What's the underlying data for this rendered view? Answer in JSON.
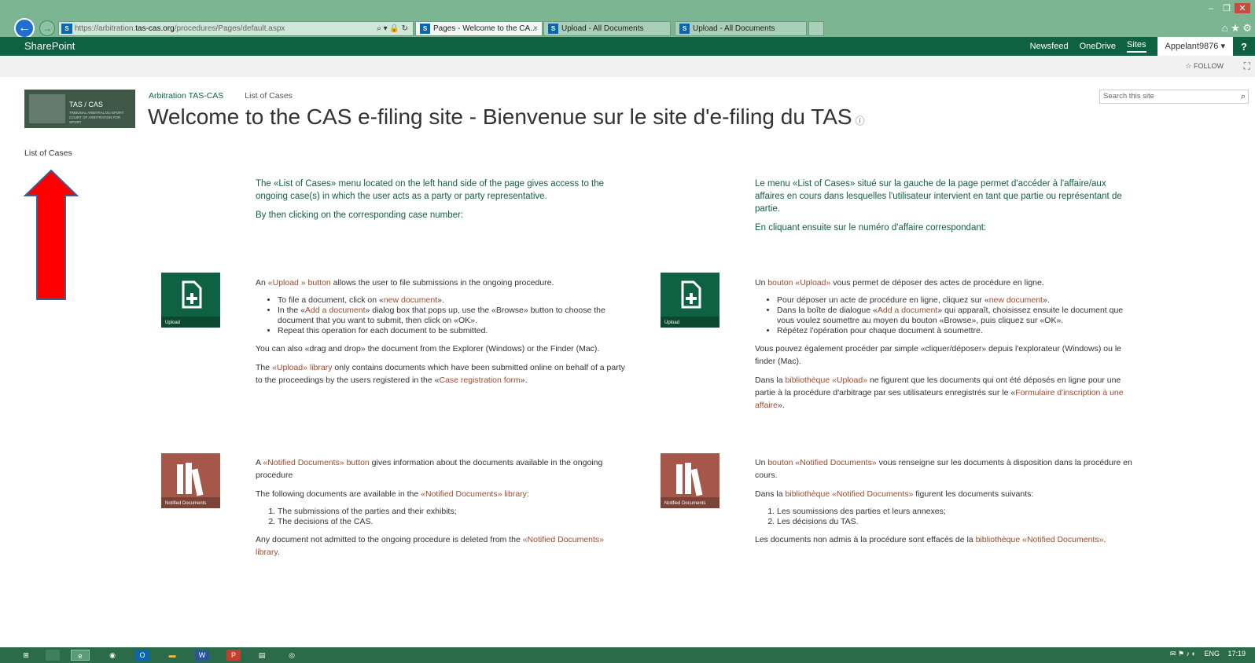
{
  "browser": {
    "url_prefix": "https://arbitration.",
    "url_host": "tas-cas.org",
    "url_path": "/procedures/Pages/default.aspx",
    "addr_icons": "⌕ ▾ 🔒 ↻",
    "tabs": [
      {
        "label": "Pages - Welcome to the CA...",
        "active": true
      },
      {
        "label": "Upload - All Documents"
      },
      {
        "label": "Upload - All Documents"
      }
    ],
    "tab_close": "×",
    "win_min": "–",
    "win_restore": "❐",
    "win_close": "✕",
    "home_icon": "⌂",
    "star_icon": "★",
    "gear_icon": "⚙"
  },
  "sp": {
    "brand": "SharePoint",
    "nav": [
      "Newsfeed",
      "OneDrive",
      "Sites"
    ],
    "user": "Appelant9876 ▾",
    "help": "?"
  },
  "ribbon": {
    "follow": "☆ FOLLOW",
    "focus": "⛶"
  },
  "logo": {
    "title": "TAS / CAS",
    "sub1": "TRIBUNAL ARBITRAL DU SPORT",
    "sub2": "COURT OF ARBITRATION FOR SPORT"
  },
  "breadcrumb": {
    "site": "Arbitration TAS-CAS",
    "page": "List of Cases"
  },
  "page_title": "Welcome to the CAS e-filing site - Bienvenue sur le site d'e-filing du TAS",
  "info_icon": "ⓘ",
  "search": {
    "placeholder": "Search this site",
    "icon": "⌕"
  },
  "left_nav": {
    "item": "List of Cases"
  },
  "en": {
    "intro1": "The «List of Cases» menu located on the left hand side of the page gives access to the ongoing case(s) in which the user acts as a party or party representative.",
    "intro2": "By then clicking on the corresponding case number:",
    "upload_a": "An ",
    "upload_link": "«Upload » button",
    "upload_b": " allows the user to file submissions in the ongoing procedure.",
    "b1_a": "To file a document, click on «",
    "b1_link": "new document",
    "b1_b": "».",
    "b2_a": "In the «",
    "b2_link": "Add a document",
    "b2_b": "» dialog box that pops up, use the «Browse» button to choose the document that you want to submit, then click on «OK».",
    "b3": "Repeat this operation for each document to be submitted.",
    "drag": "You can also «drag and drop» the document from the Explorer (Windows) or the Finder (Mac).",
    "lib_a": "The ",
    "lib_link": "«Upload» library",
    "lib_b": " only contains documents which have been submitted online on behalf of a party to the proceedings by the users registered in the «",
    "lib_link2": "Case registration form",
    "lib_c": "».",
    "nd_a": "A ",
    "nd_link": "«Notified Documents» button",
    "nd_b": " gives information about the documents available in the ongoing procedure",
    "nd2_a": "The following documents are available in the ",
    "nd2_link": "«Notified Documents» library",
    "nd2_b": ":",
    "o1": "The submissions of the parties and their exhibits;",
    "o2": "The decisions of the CAS.",
    "nd3_a": "Any document not admitted to the ongoing procedure is deleted from the ",
    "nd3_link": "«Notified Documents» library",
    "nd3_b": "."
  },
  "fr": {
    "intro1": "Le menu «List of Cases» situé sur la gauche de la page permet d'accéder à l'affaire/aux affaires en cours dans lesquelles l'utilisateur intervient en tant que partie ou représentant de partie.",
    "intro2": "En cliquant ensuite sur le numéro d'affaire correspondant:",
    "upload_a": "Un ",
    "upload_link": "bouton «Upload»",
    "upload_b": " vous permet de déposer des actes de procédure en ligne.",
    "b1_a": "Pour déposer un acte de procédure en ligne, cliquez sur «",
    "b1_link": "new document",
    "b1_b": "».",
    "b2_a": "Dans la boîte de dialogue «",
    "b2_link": "Add a document",
    "b2_b": "» qui apparaît, choisissez ensuite le document que vous voulez soumettre au moyen du bouton «Browse», puis cliquez sur «OK».",
    "b3": "Répétez l'opération pour chaque document à soumettre.",
    "drag": "Vous pouvez également procéder par simple «cliquer/déposer» depuis l'explorateur (Windows) ou le finder (Mac).",
    "lib_a": "Dans la ",
    "lib_link": "bibliothèque «Upload»",
    "lib_b": " ne figurent que les documents qui ont été déposés en ligne pour une partie à la procédure d'arbitrage par ses utilisateurs enregistrés sur le «",
    "lib_link2": "Formulaire d'inscription à une affaire",
    "lib_c": "».",
    "nd_a": "Un ",
    "nd_link": "bouton «Notified Documents»",
    "nd_b": " vous renseigne sur les documents à disposition dans la procédure en cours.",
    "nd2_a": "Dans la ",
    "nd2_link": "bibliothèque «Notified Documents»",
    "nd2_b": " figurent les documents suivants:",
    "o1": "Les soumissions des parties et leurs annexes;",
    "o2": "Les décisions du TAS.",
    "nd3_a": "Les documents non admis à la procédure sont effacés de la ",
    "nd3_link": "bibliothèque «Notified Documents»",
    "nd3_b": "."
  },
  "tiles": {
    "upload": "Upload",
    "notified": "Notified Documents"
  },
  "taskbar": {
    "tray_lang": "ENG",
    "clock": "17:19",
    "start_icon": "⊞",
    "word_icon": "W",
    "ppt_icon": "P",
    "outlook_icon": "O",
    "ie_icon": "e"
  }
}
